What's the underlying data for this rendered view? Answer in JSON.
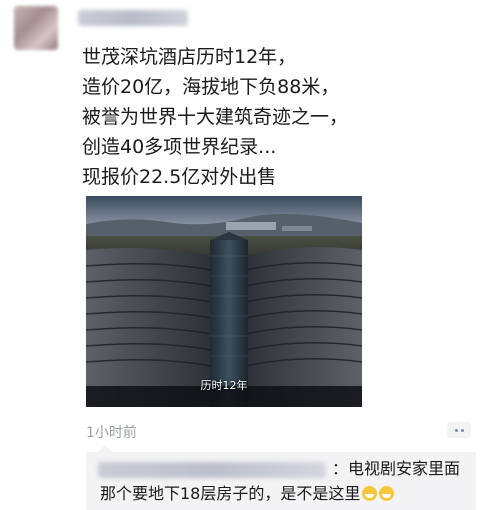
{
  "post": {
    "lines": [
      "世茂深坑酒店历时12年，",
      "造价20亿，海拔地下负88米，",
      "被誉为世界十大建筑奇迹之一，",
      "创造40多项世界纪录...",
      "现报价22.5亿对外出售"
    ],
    "video_caption": "历时12年",
    "time": "1小时前"
  },
  "comment": {
    "line1": "：电视剧安家里面",
    "line2": "那个要地下18层房子的，是不是这里"
  }
}
